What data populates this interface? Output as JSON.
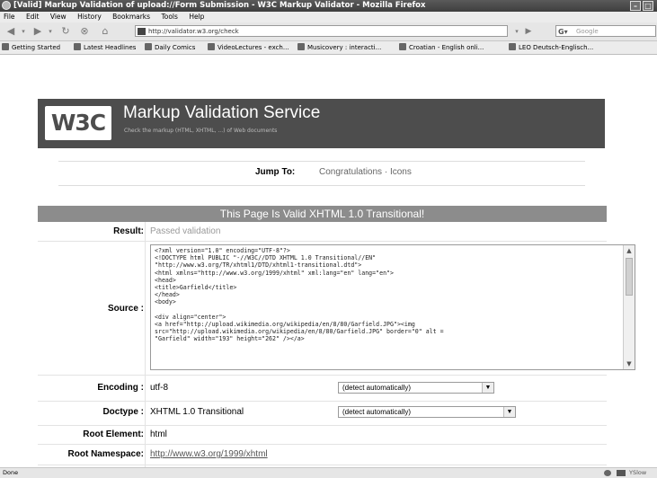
{
  "window": {
    "title": "[Valid] Markup Validation of upload://Form Submission - W3C Markup Validator - Mozilla Firefox"
  },
  "menu": [
    "File",
    "Edit",
    "View",
    "History",
    "Bookmarks",
    "Tools",
    "Help"
  ],
  "nav": {
    "url": "http://validator.w3.org/check",
    "search_placeholder": "Google"
  },
  "bookmarks": [
    "Getting Started",
    "Latest Headlines",
    "Daily Comics",
    "VideoLectures - exch...",
    "Musicovery : interacti...",
    "Croatian - English onli...",
    "LEO Deutsch-Englisch..."
  ],
  "header": {
    "logo": "W3C",
    "title": "Markup Validation Service",
    "subtitle": "Check the markup (HTML, XHTML, ...) of Web documents"
  },
  "jump": {
    "label": "Jump To:",
    "link1": "Congratulations",
    "sep": " · ",
    "link2": "Icons"
  },
  "banner": "This Page Is Valid XHTML 1.0 Transitional!",
  "rows": {
    "result_label": "Result:",
    "result_value": "Passed validation",
    "source_label": "Source :",
    "source_text": "<?xml version=\"1.0\" encoding=\"UTF-8\"?>\n<!DOCTYPE html PUBLIC \"-//W3C//DTD XHTML 1.0 Transitional//EN\"\n\"http://www.w3.org/TR/xhtml1/DTD/xhtml1-transitional.dtd\">\n<html xmlns=\"http://www.w3.org/1999/xhtml\" xml:lang=\"en\" lang=\"en\">\n<head>\n<title>Garfield</title>\n</head>\n<body>\n\n<div align=\"center\">\n<a href=\"http://upload.wikimedia.org/wikipedia/en/8/80/Garfield.JPG\"><img\nsrc=\"http://upload.wikimedia.org/wikipedia/en/8/80/Garfield.JPG\" border=\"0\" alt =\n\"Garfield\" width=\"193\" height=\"262\" /></a>",
    "encoding_label": "Encoding :",
    "encoding_value": "utf-8",
    "encoding_select": "(detect automatically)",
    "doctype_label": "Doctype :",
    "doctype_value": "XHTML 1.0 Transitional",
    "doctype_select": "(detect automatically)",
    "root_element_label": "Root Element:",
    "root_element_value": "html",
    "root_ns_label": "Root Namespace:",
    "root_ns_value": "http://www.w3.org/1999/xhtml"
  },
  "status": {
    "left": "Done",
    "right": "YSlow"
  }
}
